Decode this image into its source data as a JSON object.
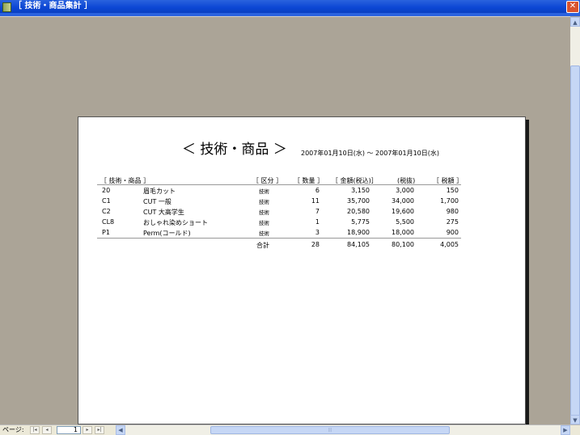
{
  "window": {
    "title": "［ 技術・商品集計 ］",
    "close_glyph": "✕"
  },
  "report": {
    "title": "＜ 技術・商品 ＞",
    "date_range": "2007年01月10日(水) ～ 2007年01月10日(水)",
    "headers": {
      "item": "［ 技術・商品 ］",
      "category": "［ 区分 ］",
      "qty": "［ 数量 ］",
      "amount_incl": "［ 金額(税込)］",
      "amount_excl": "(税抜)",
      "tax": "［ 税額 ］"
    },
    "rows": [
      {
        "code": "20",
        "name": "眉毛カット",
        "category": "技術",
        "qty": "6",
        "amount_incl": "3,150",
        "amount_excl": "3,000",
        "tax": "150"
      },
      {
        "code": "C1",
        "name": "CUT 一般",
        "category": "技術",
        "qty": "11",
        "amount_incl": "35,700",
        "amount_excl": "34,000",
        "tax": "1,700"
      },
      {
        "code": "C2",
        "name": "CUT 大高学生",
        "category": "技術",
        "qty": "7",
        "amount_incl": "20,580",
        "amount_excl": "19,600",
        "tax": "980"
      },
      {
        "code": "CL8",
        "name": "おしゃれ染めショート",
        "category": "技術",
        "qty": "1",
        "amount_incl": "5,775",
        "amount_excl": "5,500",
        "tax": "275"
      },
      {
        "code": "P1",
        "name": "Perm(コールド)",
        "category": "技術",
        "qty": "3",
        "amount_incl": "18,900",
        "amount_excl": "18,000",
        "tax": "900"
      }
    ],
    "total": {
      "label": "合計",
      "qty": "28",
      "amount_incl": "84,105",
      "amount_excl": "80,100",
      "tax": "4,005"
    }
  },
  "statusbar": {
    "page_label": "ページ:",
    "page_number": "1",
    "first_glyph": "|◂",
    "prev_glyph": "◂",
    "next_glyph": "▸",
    "last_glyph": "▸|"
  },
  "scroll": {
    "up": "▲",
    "down": "▼",
    "left": "◀",
    "right": "▶",
    "grip": "|||"
  }
}
